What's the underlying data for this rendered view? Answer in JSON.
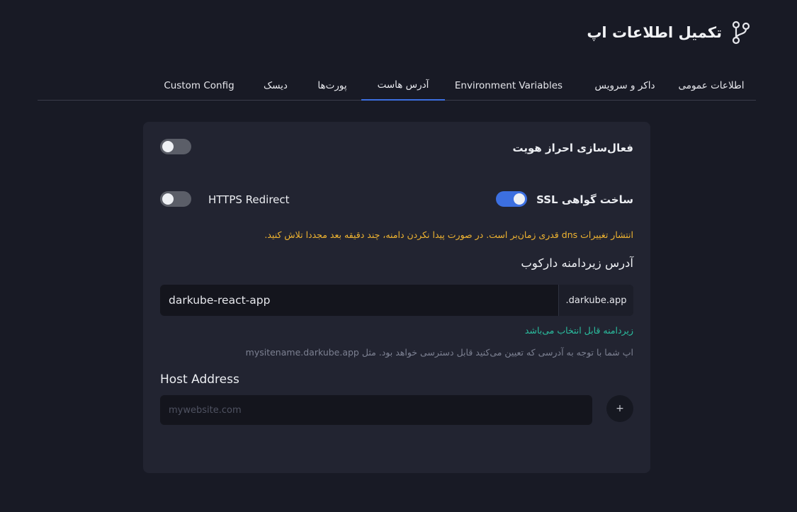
{
  "header": {
    "title": "تکمیل اطلاعات اپ",
    "icon": "git-branch-icon"
  },
  "tabs": [
    {
      "label": "اطلاعات عمومی",
      "active": false
    },
    {
      "label": "داکر و سرویس",
      "active": false
    },
    {
      "label": "Environment Variables",
      "active": false
    },
    {
      "label": "آدرس هاست",
      "active": true
    },
    {
      "label": "پورت‌ها",
      "active": false
    },
    {
      "label": "دیسک",
      "active": false
    },
    {
      "label": "Custom Config",
      "active": false
    }
  ],
  "auth": {
    "label": "فعال‌سازی احراز هویت",
    "enabled": false
  },
  "ssl": {
    "label": "ساخت گواهی SSL",
    "enabled": true
  },
  "https_redirect": {
    "label": "HTTPS Redirect",
    "enabled": false
  },
  "warning": "انتشار تغییرات dns قدری زمان‌بر است. در صورت پیدا نکردن دامنه، چند دقیقه بعد مجددا تلاش کنید.",
  "subdomain": {
    "title": "آدرس زیردامنه دارکوب",
    "value": "darkube-react-app",
    "suffix": ".darkube.app",
    "status": "زیردامنه قابل انتخاب می‌باشد",
    "help": "اپ شما با توجه به آدرسی که تعیین می‌کنید قابل دسترسی خواهد بود. مثل mysitename.darkube.app"
  },
  "host": {
    "title": "Host Address",
    "placeholder": "mywebsite.com",
    "add_label": "+"
  },
  "colors": {
    "background": "#181a25",
    "card": "#222431",
    "accent": "#3c6fe0",
    "warning": "#f0b431",
    "success": "#2bbfa0"
  }
}
